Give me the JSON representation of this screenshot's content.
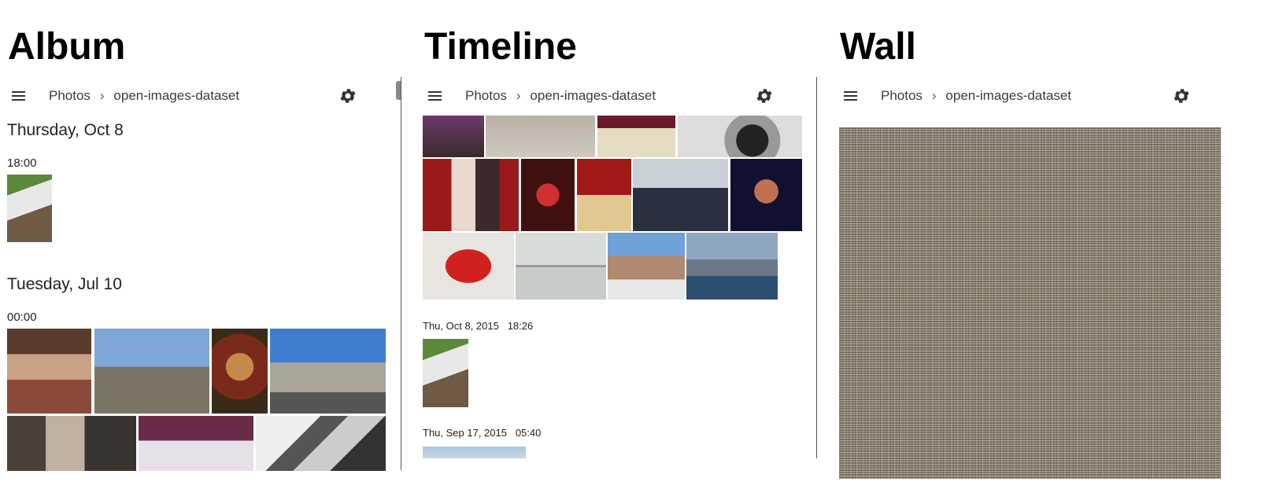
{
  "panels": {
    "album": {
      "title": "Album"
    },
    "timeline": {
      "title": "Timeline"
    },
    "wall": {
      "title": "Wall"
    }
  },
  "app_bar": {
    "root": "Photos",
    "separator": "›",
    "folder": "open-images-dataset",
    "menu_icon": "hamburger-menu-icon",
    "settings_icon": "gear-icon"
  },
  "album": {
    "groups": [
      {
        "date": "Thursday, Oct 8",
        "time": "18:00"
      },
      {
        "date": "Tuesday, Jul 10",
        "time": "00:00"
      }
    ]
  },
  "timeline": {
    "groups": [
      {
        "date": "Thu, Oct 8, 2015",
        "time": "18:26"
      },
      {
        "date": "Thu, Sep 17, 2015",
        "time": "05:40"
      }
    ]
  },
  "colors": {
    "text": "#1f1f1f",
    "icon": "#333333",
    "divider": "#555555",
    "background": "#ffffff"
  }
}
